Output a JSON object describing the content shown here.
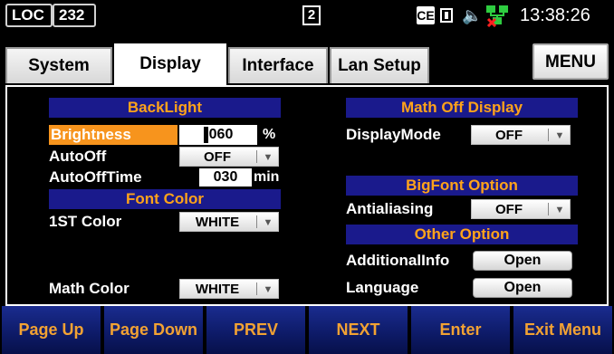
{
  "status_bar": {
    "loc": "LOC",
    "channel": "232",
    "page_indicator": "2",
    "ce_icon": "CE",
    "speaker_icon": "speaker-icon",
    "network_icon": "network-disconnected-icon",
    "time": "13:38:26"
  },
  "tabs": [
    {
      "label": "System"
    },
    {
      "label": "Display"
    },
    {
      "label": "Interface"
    },
    {
      "label": "Lan Setup"
    }
  ],
  "active_tab": "Display",
  "menu_label": "MENU",
  "backlight": {
    "header": "BackLight",
    "brightness_label": "Brightness",
    "brightness_value": "060",
    "brightness_unit": "%",
    "autooff_label": "AutoOff",
    "autooff_value": "OFF",
    "autoofftime_label": "AutoOffTime",
    "autoofftime_value": "030",
    "autoofftime_unit": "min"
  },
  "font_color": {
    "header": "Font Color",
    "first_label": "1ST Color",
    "first_value": "WHITE",
    "math_label": "Math Color",
    "math_value": "WHITE"
  },
  "math_off_display": {
    "header": "Math Off Display",
    "mode_label": "DisplayMode",
    "mode_value": "OFF"
  },
  "bigfont": {
    "header": "BigFont Option",
    "antialiasing_label": "Antialiasing",
    "antialiasing_value": "OFF"
  },
  "other": {
    "header": "Other Option",
    "additional_label": "AdditionalInfo",
    "additional_button": "Open",
    "language_label": "Language",
    "language_button": "Open"
  },
  "softkeys": [
    {
      "label": "Page Up"
    },
    {
      "label": "Page Down"
    },
    {
      "label": "PREV"
    },
    {
      "label": "NEXT"
    },
    {
      "label": "Enter"
    },
    {
      "label": "Exit Menu"
    }
  ],
  "colors": {
    "header_bg": "#1a1a8c",
    "header_text": "#ffa31a",
    "selected_bg": "#f7941d",
    "softkey_text": "#f2a233"
  }
}
